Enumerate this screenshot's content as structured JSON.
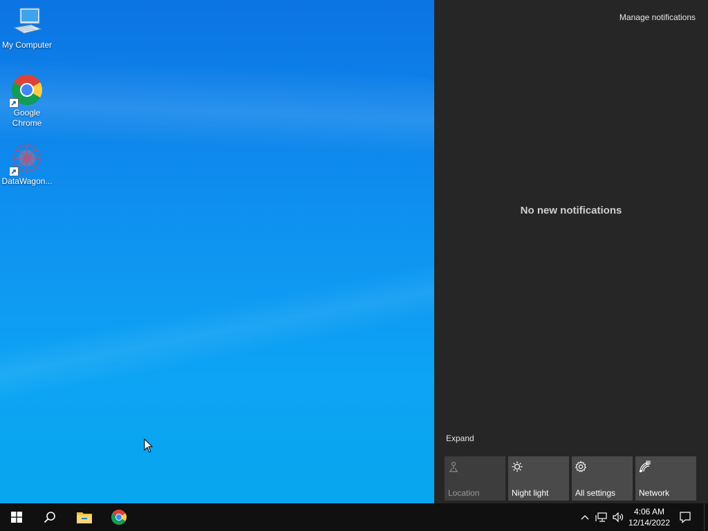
{
  "desktop": {
    "icons": [
      {
        "label": "My Computer",
        "icon": "computer-icon"
      },
      {
        "label": "Google Chrome",
        "icon": "chrome-icon"
      },
      {
        "label": "DataWagon...",
        "icon": "datawagon-icon"
      }
    ]
  },
  "action_center": {
    "manage_label": "Manage notifications",
    "empty_message": "No new notifications",
    "expand_label": "Expand",
    "quick_actions": [
      {
        "label": "Location",
        "icon": "location-icon",
        "enabled": false
      },
      {
        "label": "Night light",
        "icon": "night-light-icon",
        "enabled": true
      },
      {
        "label": "All settings",
        "icon": "gear-icon",
        "enabled": true
      },
      {
        "label": "Network",
        "icon": "network-icon",
        "enabled": true
      }
    ]
  },
  "taskbar": {
    "pinned": [
      "start-icon",
      "search-icon",
      "file-explorer-icon",
      "chrome-icon"
    ],
    "tray_icons": [
      "chevron-up-icon",
      "network-tray-icon",
      "volume-icon"
    ],
    "clock": {
      "time": "4:06 AM",
      "date": "12/14/2022"
    },
    "notification_icon": "action-center-icon"
  },
  "colors": {
    "accent": "#0a84e8",
    "panel_bg": "#262626",
    "taskbar_bg": "#101010",
    "tile_bg": "#4a4a4a"
  }
}
